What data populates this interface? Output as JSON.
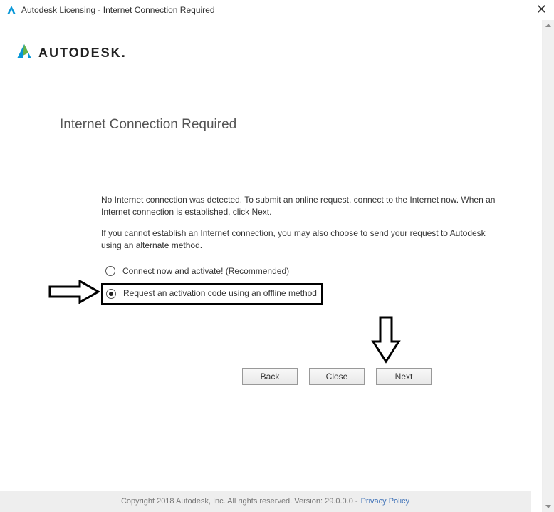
{
  "window": {
    "title": "Autodesk Licensing - Internet Connection Required"
  },
  "logo": {
    "wordmark": "AUTODESK",
    "punct": "."
  },
  "page": {
    "title": "Internet Connection Required",
    "para1": "No Internet connection was detected. To submit an online request, connect to the Internet now. When an Internet connection is established, click Next.",
    "para2": "If you cannot establish an Internet connection, you may also choose to send your request to Autodesk using an alternate method."
  },
  "radios": {
    "option1": {
      "label": "Connect now and activate! (Recommended)",
      "selected": false
    },
    "option2": {
      "label": "Request an activation code using an offline method",
      "selected": true
    }
  },
  "buttons": {
    "back": "Back",
    "close": "Close",
    "next": "Next"
  },
  "footer": {
    "copyright": "Copyright 2018 Autodesk, Inc. All rights reserved. Version: 29.0.0.0 -",
    "privacy": "Privacy Policy"
  }
}
